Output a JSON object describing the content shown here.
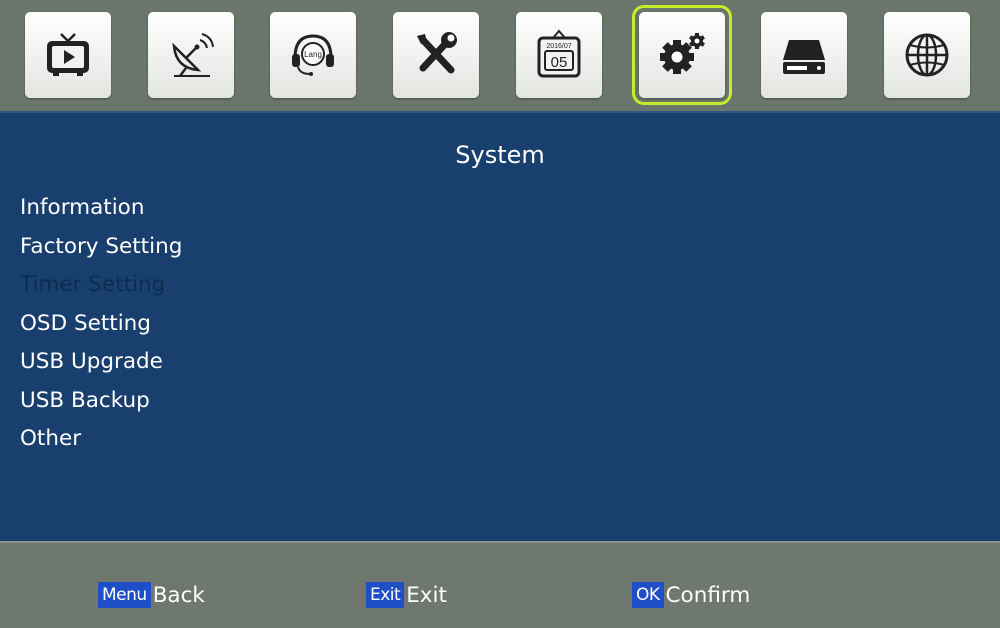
{
  "top_menu": {
    "items": [
      {
        "name": "tv-icon"
      },
      {
        "name": "satellite-dish-icon"
      },
      {
        "name": "language-headset-icon",
        "text": "Lang"
      },
      {
        "name": "tools-icon"
      },
      {
        "name": "calendar-icon",
        "date_top": "2016/07",
        "date_day": "05"
      },
      {
        "name": "gears-icon",
        "selected": true
      },
      {
        "name": "hard-drive-icon"
      },
      {
        "name": "globe-icon"
      }
    ]
  },
  "system": {
    "title": "System",
    "items": [
      {
        "label": "Information",
        "enabled": true
      },
      {
        "label": "Factory Setting",
        "enabled": true
      },
      {
        "label": "Timer Setting",
        "enabled": false
      },
      {
        "label": "OSD Setting",
        "enabled": true
      },
      {
        "label": "USB Upgrade",
        "enabled": true
      },
      {
        "label": "USB Backup",
        "enabled": true
      },
      {
        "label": "Other",
        "enabled": true
      }
    ]
  },
  "footer": {
    "menu": {
      "key": "Menu",
      "label": "Back"
    },
    "exit": {
      "key": "Exit",
      "label": "Exit"
    },
    "ok": {
      "key": "OK",
      "label": "Confirm"
    }
  },
  "colors": {
    "panel": "#183f6d",
    "bar": "#6e786f",
    "selection": "#c8ec2a",
    "key": "#1f4fc8",
    "disabled": "#0e2c52"
  }
}
